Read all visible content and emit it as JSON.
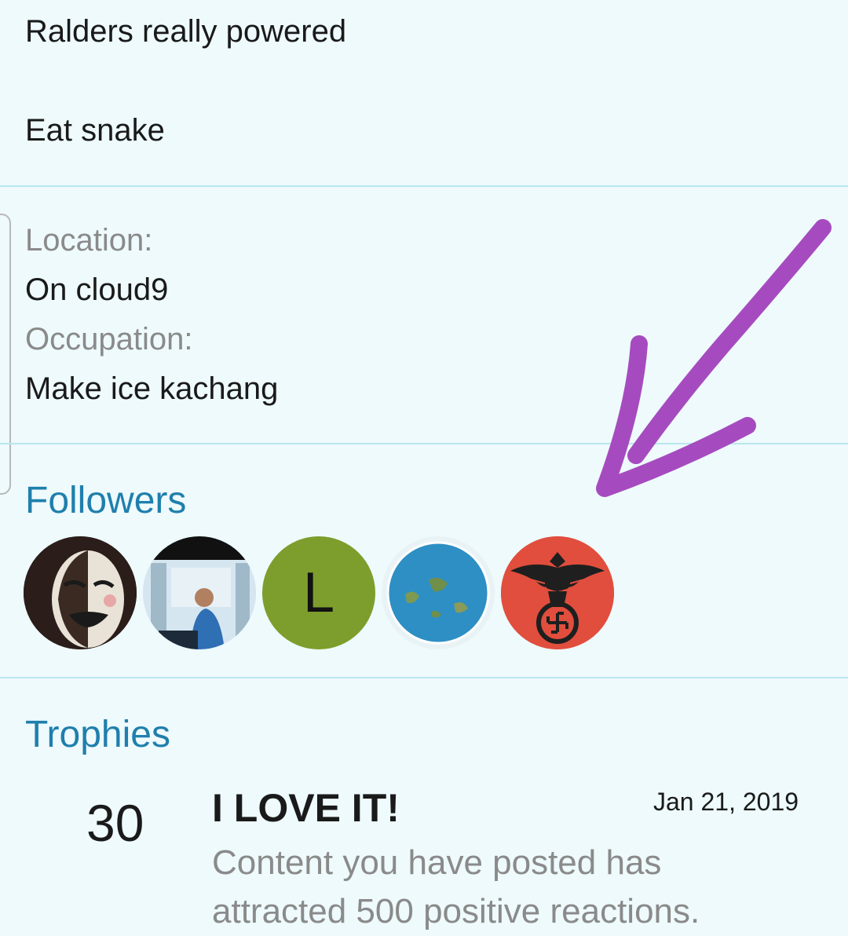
{
  "about": {
    "lines": [
      "Ralders really powered",
      "Eat snake"
    ]
  },
  "profile_fields": {
    "location_label": "Location:",
    "location_value": "On cloud9",
    "occupation_label": "Occupation:",
    "occupation_value": "Make ice kachang"
  },
  "followers": {
    "title": "Followers",
    "avatars": [
      {
        "kind": "image",
        "icon": "mask-avatar"
      },
      {
        "kind": "image",
        "icon": "photo-avatar"
      },
      {
        "kind": "letter",
        "letter": "L",
        "color": "#7d9e2c"
      },
      {
        "kind": "image",
        "icon": "flat-earth-avatar"
      },
      {
        "kind": "image",
        "icon": "eagle-emblem-avatar"
      }
    ]
  },
  "trophies": {
    "title": "Trophies",
    "items": [
      {
        "points": "30",
        "title": "I LOVE IT!",
        "date": "Jan 21, 2019",
        "description": "Content you have posted has attracted 500 positive reactions."
      }
    ]
  },
  "annotation": {
    "color": "#a64bbf",
    "icon": "hand-drawn-arrow"
  },
  "colors": {
    "accent": "#1f7fad",
    "background": "#eefafc",
    "divider": "#b9e6ef"
  }
}
